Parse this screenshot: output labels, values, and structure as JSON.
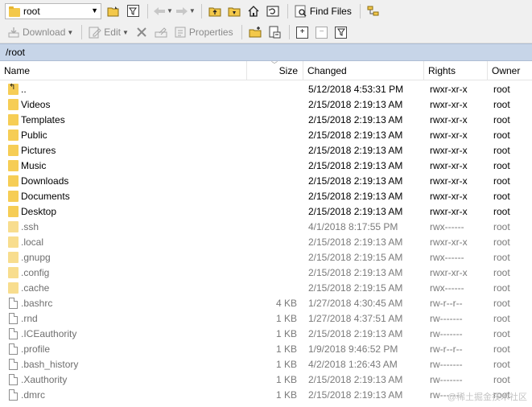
{
  "toolbar1": {
    "location": "root",
    "find_files": "Find Files"
  },
  "toolbar2": {
    "download": "Download",
    "edit": "Edit",
    "properties": "Properties"
  },
  "path": "/root",
  "columns": {
    "name": "Name",
    "size": "Size",
    "changed": "Changed",
    "rights": "Rights",
    "owner": "Owner"
  },
  "rows": [
    {
      "name": "..",
      "size": "",
      "changed": "5/12/2018 4:53:31 PM",
      "rights": "rwxr-xr-x",
      "owner": "root",
      "kind": "up",
      "hidden": false
    },
    {
      "name": "Videos",
      "size": "",
      "changed": "2/15/2018 2:19:13 AM",
      "rights": "rwxr-xr-x",
      "owner": "root",
      "kind": "folder",
      "hidden": false
    },
    {
      "name": "Templates",
      "size": "",
      "changed": "2/15/2018 2:19:13 AM",
      "rights": "rwxr-xr-x",
      "owner": "root",
      "kind": "folder",
      "hidden": false
    },
    {
      "name": "Public",
      "size": "",
      "changed": "2/15/2018 2:19:13 AM",
      "rights": "rwxr-xr-x",
      "owner": "root",
      "kind": "folder",
      "hidden": false
    },
    {
      "name": "Pictures",
      "size": "",
      "changed": "2/15/2018 2:19:13 AM",
      "rights": "rwxr-xr-x",
      "owner": "root",
      "kind": "folder",
      "hidden": false
    },
    {
      "name": "Music",
      "size": "",
      "changed": "2/15/2018 2:19:13 AM",
      "rights": "rwxr-xr-x",
      "owner": "root",
      "kind": "folder",
      "hidden": false
    },
    {
      "name": "Downloads",
      "size": "",
      "changed": "2/15/2018 2:19:13 AM",
      "rights": "rwxr-xr-x",
      "owner": "root",
      "kind": "folder",
      "hidden": false
    },
    {
      "name": "Documents",
      "size": "",
      "changed": "2/15/2018 2:19:13 AM",
      "rights": "rwxr-xr-x",
      "owner": "root",
      "kind": "folder",
      "hidden": false
    },
    {
      "name": "Desktop",
      "size": "",
      "changed": "2/15/2018 2:19:13 AM",
      "rights": "rwxr-xr-x",
      "owner": "root",
      "kind": "folder",
      "hidden": false
    },
    {
      "name": ".ssh",
      "size": "",
      "changed": "4/1/2018 8:17:55 PM",
      "rights": "rwx------",
      "owner": "root",
      "kind": "folder",
      "hidden": true
    },
    {
      "name": ".local",
      "size": "",
      "changed": "2/15/2018 2:19:13 AM",
      "rights": "rwxr-xr-x",
      "owner": "root",
      "kind": "folder",
      "hidden": true
    },
    {
      "name": ".gnupg",
      "size": "",
      "changed": "2/15/2018 2:19:15 AM",
      "rights": "rwx------",
      "owner": "root",
      "kind": "folder",
      "hidden": true
    },
    {
      "name": ".config",
      "size": "",
      "changed": "2/15/2018 2:19:13 AM",
      "rights": "rwxr-xr-x",
      "owner": "root",
      "kind": "folder",
      "hidden": true
    },
    {
      "name": ".cache",
      "size": "",
      "changed": "2/15/2018 2:19:15 AM",
      "rights": "rwx------",
      "owner": "root",
      "kind": "folder",
      "hidden": true
    },
    {
      "name": ".bashrc",
      "size": "4 KB",
      "changed": "1/27/2018 4:30:45 AM",
      "rights": "rw-r--r--",
      "owner": "root",
      "kind": "file",
      "hidden": true
    },
    {
      "name": ".rnd",
      "size": "1 KB",
      "changed": "1/27/2018 4:37:51 AM",
      "rights": "rw-------",
      "owner": "root",
      "kind": "file",
      "hidden": true
    },
    {
      "name": ".ICEauthority",
      "size": "1 KB",
      "changed": "2/15/2018 2:19:13 AM",
      "rights": "rw-------",
      "owner": "root",
      "kind": "file",
      "hidden": true
    },
    {
      "name": ".profile",
      "size": "1 KB",
      "changed": "1/9/2018 9:46:52 PM",
      "rights": "rw-r--r--",
      "owner": "root",
      "kind": "file",
      "hidden": true
    },
    {
      "name": ".bash_history",
      "size": "1 KB",
      "changed": "4/2/2018 1:26:43 AM",
      "rights": "rw-------",
      "owner": "root",
      "kind": "file",
      "hidden": true
    },
    {
      "name": ".Xauthority",
      "size": "1 KB",
      "changed": "2/15/2018 2:19:13 AM",
      "rights": "rw-------",
      "owner": "root",
      "kind": "file",
      "hidden": true
    },
    {
      "name": ".dmrc",
      "size": "1 KB",
      "changed": "2/15/2018 2:19:13 AM",
      "rights": "rw-------",
      "owner": "root",
      "kind": "file",
      "hidden": true
    }
  ],
  "watermark": "@稀土掘金技术社区",
  "colors": {
    "path_bar": "#c7d5e8",
    "folder": "#f6cd55",
    "hidden_text": "#7a7a7a"
  }
}
